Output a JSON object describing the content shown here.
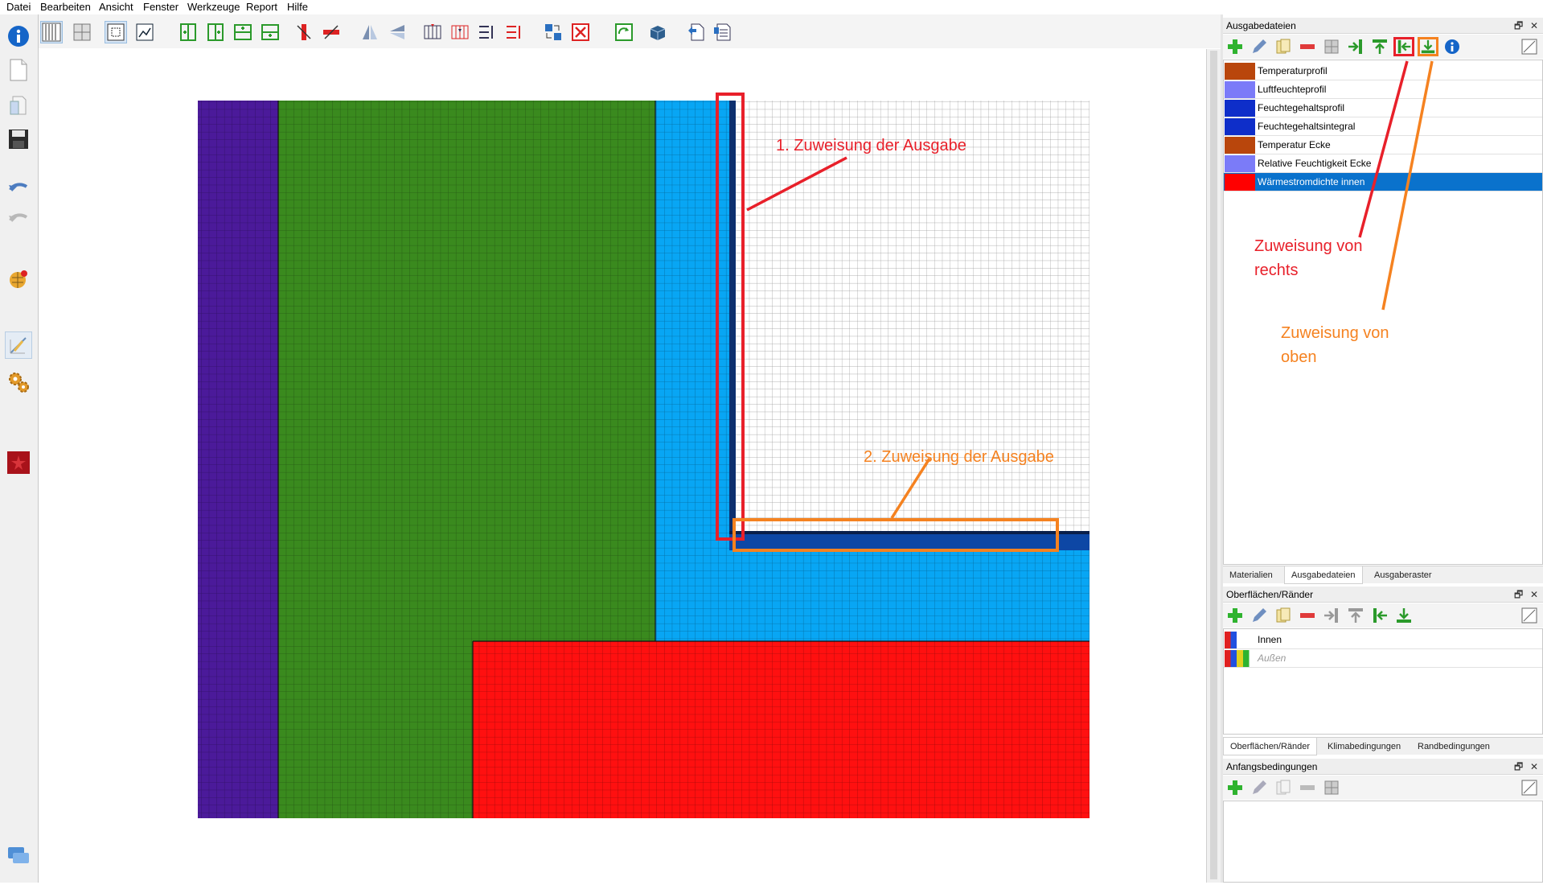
{
  "menu": [
    "Datei",
    "Bearbeiten",
    "Ansicht",
    "Fenster",
    "Werkzeuge",
    "Report",
    "Hilfe"
  ],
  "panels": {
    "outputs": {
      "title": "Ausgabedateien",
      "float_ctl": "🗗",
      "close_ctl": "✕",
      "items": [
        {
          "label": "Temperaturprofil",
          "color": "#b9460c"
        },
        {
          "label": "Luftfeuchteprofil",
          "color": "#7b7bf8"
        },
        {
          "label": "Feuchtegehaltsprofil",
          "color": "#0e2ec9"
        },
        {
          "label": "Feuchtegehaltsintegral",
          "color": "#0e2ec9"
        },
        {
          "label": "Temperatur Ecke",
          "color": "#b9460c"
        },
        {
          "label": "Relative Feuchtigkeit Ecke",
          "color": "#7b7bf8"
        },
        {
          "label": "Wärmestromdichte innen",
          "color": "#ff0000"
        }
      ],
      "selected_index": 6,
      "tabs": [
        "Materialien",
        "Ausgabedateien",
        "Ausgaberaster"
      ],
      "active_tab": 1
    },
    "surfaces": {
      "title": "Oberflächen/Ränder",
      "float_ctl": "🗗",
      "close_ctl": "✕",
      "items": [
        {
          "label": "Innen"
        },
        {
          "label": "Außen"
        }
      ],
      "tabs": [
        "Oberflächen/Ränder",
        "Klimabedingungen",
        "Randbedingungen"
      ],
      "active_tab": 0
    },
    "initial": {
      "title": "Anfangsbedingungen",
      "float_ctl": "🗗",
      "close_ctl": "✕"
    }
  },
  "annotations": {
    "first": "1. Zuweisung der Ausgabe",
    "second": "2. Zuweisung der Ausgabe",
    "right_line1": "Zuweisung von",
    "right_line2": "rechts",
    "top_line1": "Zuweisung von",
    "top_line2": "oben",
    "red_color": "#e8202a",
    "orange_color": "#f58220"
  },
  "materials": {
    "purple": "#4b1a9a",
    "green": "#3a8a1e",
    "light_blue": "#08a6f4",
    "red": "#ff1010",
    "dark_blue": "#0d47a5"
  },
  "icons": {
    "left_bar": [
      "info-icon",
      "new-file-icon",
      "open-file-icon",
      "save-icon",
      "undo-icon",
      "redo-icon",
      "globe-icon",
      "edit-view-icon",
      "settings-icon",
      "stop-icon",
      "chat-icon"
    ]
  }
}
